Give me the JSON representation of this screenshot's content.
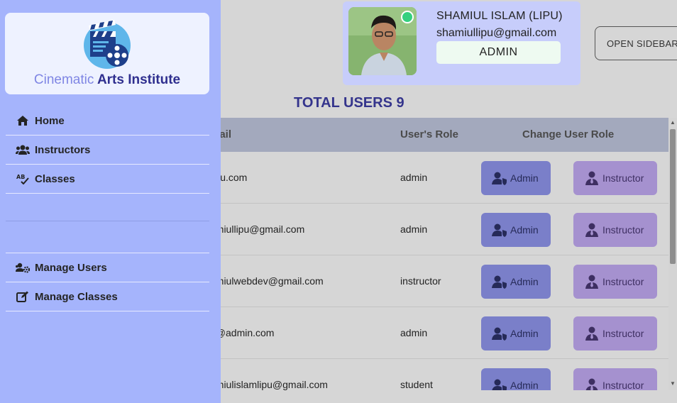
{
  "sidebar": {
    "brand": {
      "name_part1": "Cinematic",
      "name_part2": "Arts Institute",
      "logo_icon": "clapperboard-film-reel-icon"
    },
    "nav_items": [
      {
        "label": "Home",
        "icon": "home-icon"
      },
      {
        "label": "Instructors",
        "icon": "users-icon"
      },
      {
        "label": "Classes",
        "icon": "spell-check-icon"
      }
    ],
    "admin_items": [
      {
        "label": "Manage Users",
        "icon": "users-cog-icon"
      },
      {
        "label": "Manage Classes",
        "icon": "edit-icon"
      }
    ]
  },
  "profile": {
    "name": "SHAMIUL ISLAM (LIPU)",
    "email": "shamiullipu@gmail.com",
    "role": "ADMIN",
    "online": true
  },
  "header": {
    "open_sidebar_label": "OPEN SIDEBAR"
  },
  "total_users_label": "TOTAL USERS 9",
  "table": {
    "columns": [
      "mail",
      "User's Role",
      "Change User Role"
    ],
    "rows": [
      {
        "email": "@u.com",
        "role": "admin",
        "admin_btn": "Admin",
        "instructor_btn": "Instructor"
      },
      {
        "email": "amiullipu@gmail.com",
        "role": "admin",
        "admin_btn": "Admin",
        "instructor_btn": "Instructor"
      },
      {
        "email": "amiulwebdev@gmail.com",
        "role": "instructor",
        "admin_btn": "Admin",
        "instructor_btn": "Instructor"
      },
      {
        "email": "n@admin.com",
        "role": "admin",
        "admin_btn": "Admin",
        "instructor_btn": "Instructor"
      },
      {
        "email": "amiulislamlipu@gmail.com",
        "role": "student",
        "admin_btn": "Admin",
        "instructor_btn": "Instructor"
      }
    ]
  },
  "colors": {
    "sidebar_bg": "#a5b4fc",
    "brand_card_bg": "#eef2ff",
    "profile_card_bg": "#c7cdfb",
    "admin_button": "#7a7fc9",
    "instructor_button": "#a591cf",
    "total_users_text": "#34348c",
    "online_indicator": "#35d07f"
  }
}
